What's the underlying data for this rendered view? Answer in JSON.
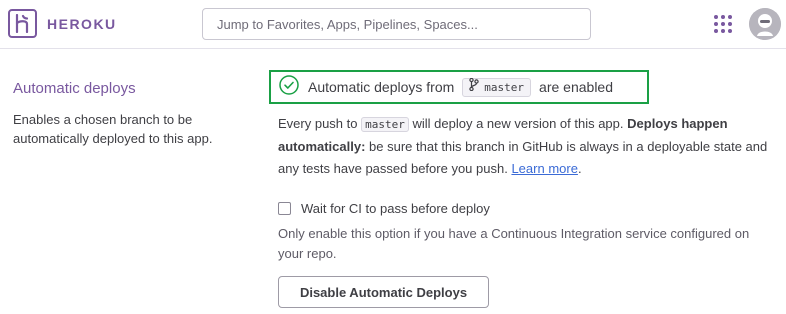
{
  "header": {
    "logo_text": "HEROKU",
    "search_placeholder": "Jump to Favorites, Apps, Pipelines, Spaces..."
  },
  "section": {
    "title": "Automatic deploys",
    "description": "Enables a chosen branch to be automatically deployed to this app."
  },
  "status": {
    "prefix": "Automatic deploys from",
    "branch": "master",
    "suffix": "are enabled",
    "color": "#1aa045"
  },
  "info": {
    "part1": "Every push to",
    "branch": "master",
    "part2": "will deploy a new version of this app.",
    "bold": "Deploys happen automatically:",
    "part3": "be sure that this branch in GitHub is always in a deployable state and any tests have passed before you push.",
    "link": "Learn more",
    "end": "."
  },
  "ci": {
    "label": "Wait for CI to pass before deploy",
    "checked": false,
    "help": "Only enable this option if you have a Continuous Integration service configured on your repo."
  },
  "button": {
    "disable_label": "Disable Automatic Deploys"
  },
  "colors": {
    "brand": "#79589f",
    "link": "#3b6bd6"
  }
}
